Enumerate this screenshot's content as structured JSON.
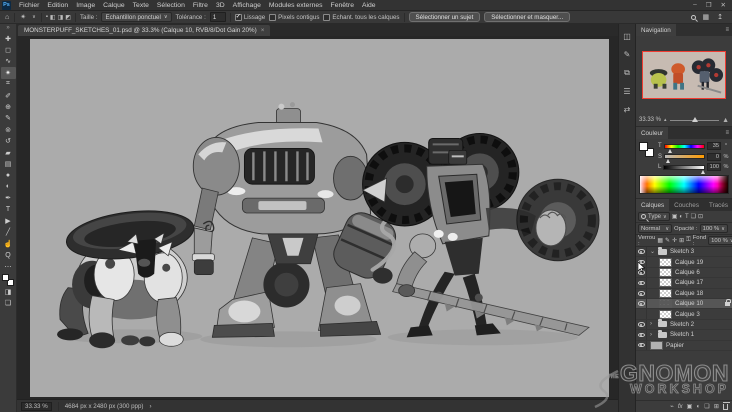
{
  "app": {
    "logo_text": "Ps"
  },
  "window_controls": {
    "minimize": "–",
    "restore": "❐",
    "close": "✕"
  },
  "menubar": {
    "items": [
      "Fichier",
      "Edition",
      "Image",
      "Calque",
      "Texte",
      "Sélection",
      "Filtre",
      "3D",
      "Affichage",
      "Modules externes",
      "Fenêtre",
      "Aide"
    ]
  },
  "options_bar": {
    "taille_label": "Taille :",
    "taille_value": "Echantillon ponctuel",
    "tolerance_label": "Tolérance :",
    "tolerance_value": "1",
    "checkboxes": [
      {
        "label": "Lissage",
        "checked": true,
        "mark": "✓"
      },
      {
        "label": "Pixels contigus",
        "checked": false,
        "mark": ""
      },
      {
        "label": "Echant. tous les calques",
        "checked": false,
        "mark": ""
      }
    ],
    "select_subject_button": "Sélectionner un sujet",
    "select_mask_button": "Sélectionner et masquer..."
  },
  "document_tab": {
    "title": "MONSTERPUFF_SKETCHES_01.psd @ 33.3% (Calque 10, RVB/8/Dot Gain 20%)",
    "close_glyph": "×"
  },
  "icons": {
    "chevrons": "»",
    "dropdown": "∨",
    "home": "⌂",
    "wand_preset": "✴",
    "new_selection": "▪",
    "add_selection": "◧",
    "subtract_selection": "◨",
    "intersect_selection": "◩",
    "move": "✚",
    "marquee": "◻",
    "lasso": "∿",
    "wand": "✴",
    "crop": "⌗",
    "eyedropper": "✐",
    "healing": "⊕",
    "brush": "✎",
    "stamp": "⊚",
    "history": "↺",
    "eraser": "▰",
    "gradient": "▤",
    "blur": "●",
    "dodge": "◐",
    "pen": "✒",
    "type": "T",
    "path_select": "▶",
    "shape": "╱",
    "hand": "☝",
    "zoom": "Q",
    "more": "⋯",
    "mask_mode": "◨",
    "screen_mode": "❏",
    "workspace": "▦",
    "share": "↥",
    "panel_properties": "◫",
    "panel_brushes": "✎",
    "panel_clone": "⧉",
    "panel_character": "☰",
    "panel_adjust": "⇄",
    "panel_menu": "≡",
    "mtn_small": "▴",
    "mtn_big": "▲",
    "filter_pixel": "▣",
    "filter_adjust": "◐",
    "filter_type": "T",
    "filter_shape": "❏",
    "filter_smart": "⊡",
    "lock_checker": "▦",
    "lock_brush": "✎",
    "lock_move": "✛",
    "lock_board": "⊞",
    "lock_full": "⚿",
    "expand_open": "⌄",
    "expand_closed": "›",
    "link": "⌁",
    "fx": "fx",
    "mask": "▣",
    "adjust": "◐",
    "group": "❏",
    "new_layer": "⊞"
  },
  "navigator": {
    "title": "Navigation",
    "zoom_value": "33.33 %"
  },
  "color_panel": {
    "title": "Couleur",
    "sliders": [
      {
        "label": "T",
        "value": "35",
        "unit": "°"
      },
      {
        "label": "S",
        "value": "0",
        "unit": "%"
      },
      {
        "label": "L",
        "value": "100",
        "unit": "%"
      }
    ]
  },
  "layers_panel": {
    "tabs": [
      "Calques",
      "Couches",
      "Tracés"
    ],
    "search_filter_label": "Type",
    "blend_mode": "Normal",
    "opacity_label": "Opacité :",
    "opacity_value": "100 %",
    "lock_label": "Verrou :",
    "fill_label": "Fond :",
    "fill_value": "100 %",
    "layers": [
      {
        "name": "Sketch 3",
        "type": "group",
        "expanded": true,
        "visible": true
      },
      {
        "name": "Calque 19",
        "type": "layer",
        "visible": true
      },
      {
        "name": "Calque 6",
        "type": "layer",
        "visible": true
      },
      {
        "name": "Calque 17",
        "type": "layer",
        "visible": true
      },
      {
        "name": "Calque 18",
        "type": "layer",
        "visible": true
      },
      {
        "name": "Calque 10",
        "type": "layer",
        "visible": true,
        "selected": true,
        "locked": true
      },
      {
        "name": "Calque 3",
        "type": "layer",
        "visible": false
      },
      {
        "name": "Sketch 2",
        "type": "group",
        "expanded": false,
        "visible": true
      },
      {
        "name": "Sketch 1",
        "type": "group",
        "expanded": false,
        "visible": true
      },
      {
        "name": "Papier",
        "type": "layer",
        "visible": true
      }
    ]
  },
  "status_bar": {
    "zoom_value": "33.33 %",
    "doc_info": "4684 px x 2480 px (300 ppp)",
    "chevron": "›"
  },
  "watermark": {
    "the": "THE",
    "line1": "GNOMON",
    "line2": "WORKSHOP"
  },
  "colors": {
    "accent_red": "#f03c32",
    "canvas_gray": "#ababab"
  }
}
